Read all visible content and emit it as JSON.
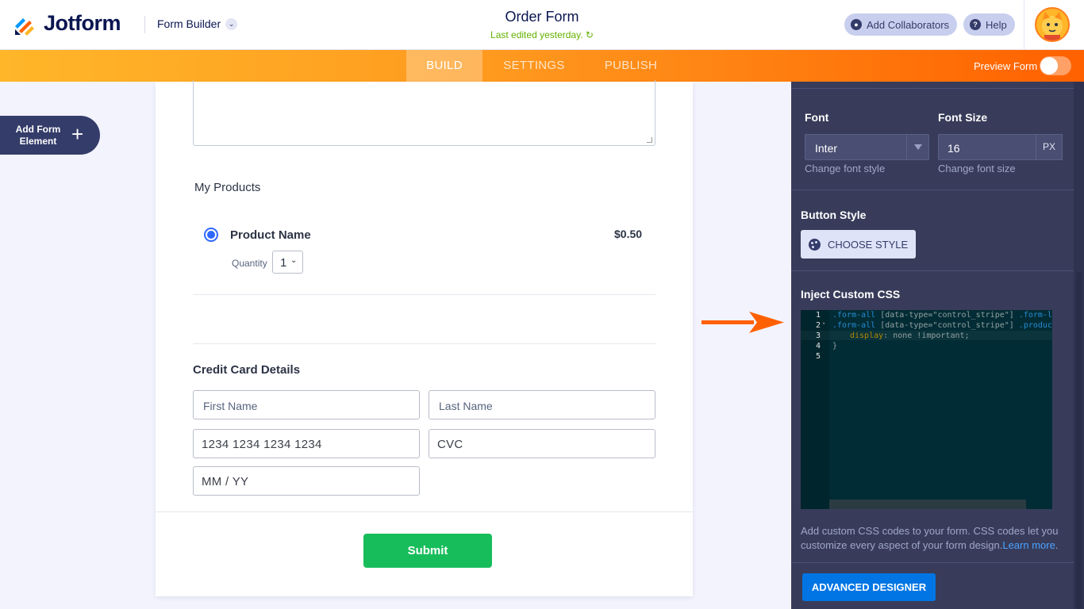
{
  "header": {
    "logo_text": "Jotform",
    "builder_label": "Form Builder",
    "form_title": "Order Form",
    "last_edited": "Last edited yesterday.",
    "collaborators_label": "Add Collaborators",
    "help_label": "Help"
  },
  "nav": {
    "tabs": [
      {
        "label": "BUILD",
        "active": true
      },
      {
        "label": "SETTINGS",
        "active": false
      },
      {
        "label": "PUBLISH",
        "active": false
      }
    ],
    "preview_label": "Preview Form"
  },
  "left": {
    "add_element_label": "Add Form Element",
    "add_icon": "plus-icon"
  },
  "form": {
    "products_label": "My Products",
    "product": {
      "name": "Product Name",
      "price": "$0.50",
      "quantity_label": "Quantity",
      "quantity_value": "1"
    },
    "credit_card_title": "Credit Card Details",
    "fields": {
      "first_name": "First Name",
      "last_name": "Last Name",
      "card_number": "1234 1234 1234 1234",
      "cvc": "CVC",
      "expiry": "MM / YY"
    },
    "submit_label": "Submit"
  },
  "panel": {
    "font_label": "Font",
    "font_value": "Inter",
    "font_hint": "Change font style",
    "font_size_label": "Font Size",
    "font_size_value": "16",
    "font_size_unit": "PX",
    "font_size_hint": "Change font size",
    "button_style_label": "Button Style",
    "choose_style_label": "CHOOSE STYLE",
    "custom_css_label": "Inject Custom CSS",
    "code_line_numbers": [
      "1",
      "2",
      "3",
      "4",
      "5"
    ],
    "code": {
      "l1_sel": ".form-all",
      "l1_attr": " [data-type=\"control_stripe\"] ",
      "l1_sel2": ".form-la",
      "l2_sel": ".form-all",
      "l2_attr": " [data-type=\"control_stripe\"] ",
      "l2_sel2": ".product",
      "l3_prop": "display",
      "l3_rest": ": none !important;",
      "l4": "}"
    },
    "css_hint_text": "Add custom CSS codes to your form. CSS codes let you customize every aspect of your form design.",
    "learn_more": "Learn more",
    "css_hint_end": ".",
    "advanced_label": "ADVANCED DESIGNER"
  },
  "colors": {
    "brand_orange": "#ff6100",
    "accent_green": "#18bd5b",
    "accent_blue": "#0075e3",
    "panel_bg": "#383c5a"
  }
}
